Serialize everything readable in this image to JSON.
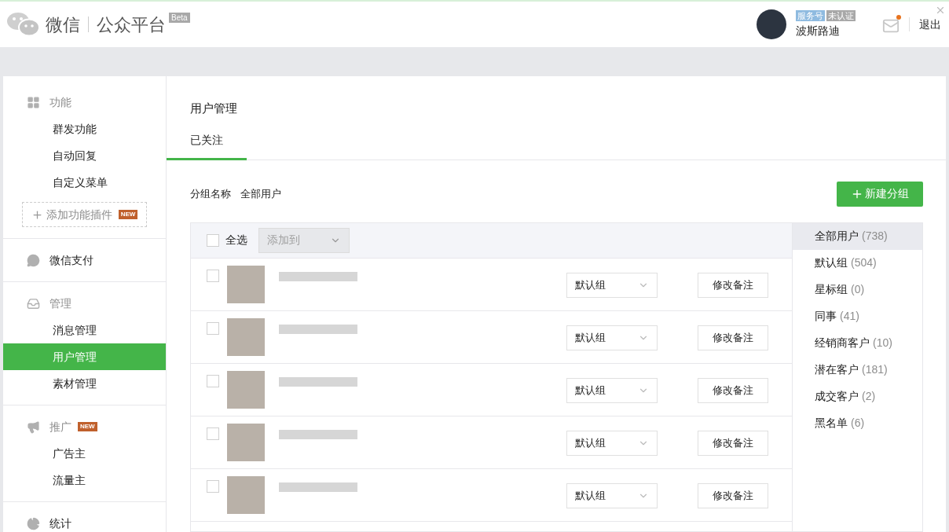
{
  "header": {
    "logo_text": "微信",
    "product": "公众平台",
    "beta": "Beta",
    "account_type": "服务号",
    "verify_status": "未认证",
    "account_name": "波斯路迪",
    "mail_unread": true,
    "logout": "退出"
  },
  "sidebar": {
    "sections": [
      {
        "label": "功能",
        "items": [
          {
            "label": "群发功能",
            "selected": false
          },
          {
            "label": "自动回复",
            "selected": false
          },
          {
            "label": "自定义菜单",
            "selected": false
          }
        ],
        "add_plugin": {
          "label": "添加功能插件",
          "badge": "NEW"
        }
      },
      {
        "label": "微信支付"
      },
      {
        "label": "管理",
        "items": [
          {
            "label": "消息管理",
            "selected": false
          },
          {
            "label": "用户管理",
            "selected": true
          },
          {
            "label": "素材管理",
            "selected": false
          }
        ]
      },
      {
        "label": "推广",
        "badge": "NEW",
        "items": [
          {
            "label": "广告主",
            "selected": false
          },
          {
            "label": "流量主",
            "selected": false
          }
        ]
      },
      {
        "label": "统计"
      }
    ]
  },
  "main": {
    "title": "用户管理",
    "tabs": [
      {
        "label": "已关注",
        "selected": true
      }
    ],
    "group_label": "分组名称",
    "group_name": "全部用户",
    "new_group": "新建分组",
    "select_all": {
      "label": "全选",
      "checked": false
    },
    "add_to": {
      "placeholder": "添加到"
    },
    "rows": [
      {
        "checked": false,
        "group": "默认组",
        "action": "修改备注"
      },
      {
        "checked": false,
        "group": "默认组",
        "action": "修改备注"
      },
      {
        "checked": false,
        "group": "默认组",
        "action": "修改备注"
      },
      {
        "checked": false,
        "group": "默认组",
        "action": "修改备注"
      },
      {
        "checked": false,
        "group": "默认组",
        "action": "修改备注"
      }
    ],
    "groups": [
      {
        "name": "全部用户",
        "count": "(738)",
        "selected": true
      },
      {
        "name": "默认组",
        "count": "(504)",
        "selected": false
      },
      {
        "name": "星标组",
        "count": "(0)",
        "selected": false
      },
      {
        "name": "同事",
        "count": "(41)",
        "selected": false
      },
      {
        "name": "经销商客户",
        "count": "(10)",
        "selected": false
      },
      {
        "name": "潜在客户",
        "count": "(181)",
        "selected": false
      },
      {
        "name": "成交客户",
        "count": "(2)",
        "selected": false
      },
      {
        "name": "黑名单",
        "count": "(6)",
        "selected": false
      }
    ]
  }
}
